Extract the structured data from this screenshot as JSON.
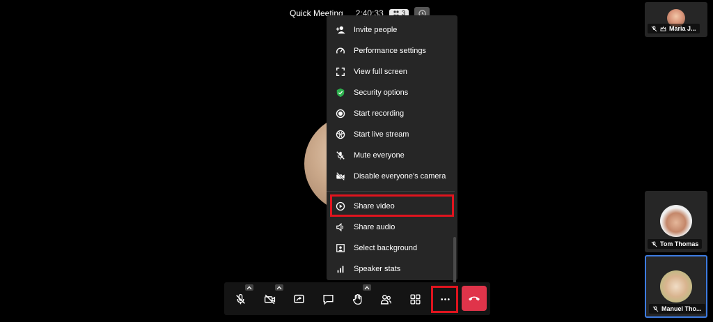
{
  "meeting": {
    "title": "Quick Meeting",
    "timer": "2:40:33",
    "participant_count": "3"
  },
  "menu": {
    "items": [
      {
        "label": "Invite people",
        "icon": "invite-people-icon"
      },
      {
        "label": "Performance settings",
        "icon": "performance-gauge-icon"
      },
      {
        "label": "View full screen",
        "icon": "fullscreen-icon"
      },
      {
        "label": "Security options",
        "icon": "security-shield-icon"
      },
      {
        "label": "Start recording",
        "icon": "record-icon"
      },
      {
        "label": "Start live stream",
        "icon": "live-stream-icon"
      },
      {
        "label": "Mute everyone",
        "icon": "mute-everyone-icon"
      },
      {
        "label": "Disable everyone's camera",
        "icon": "disable-camera-icon"
      },
      {
        "label": "Share video",
        "icon": "play-circle-icon"
      },
      {
        "label": "Share audio",
        "icon": "speaker-icon"
      },
      {
        "label": "Select background",
        "icon": "background-image-icon"
      },
      {
        "label": "Speaker stats",
        "icon": "stats-bars-icon"
      }
    ],
    "highlighted": "Share video"
  },
  "participants": [
    {
      "name": "Maria J...",
      "muted": true,
      "moderator": true
    },
    {
      "name": "Tom Thomas",
      "muted": true
    },
    {
      "name": "Manuel Tho...",
      "muted": true,
      "active_speaker": true
    }
  ],
  "colors": {
    "highlight": "#e0141e",
    "hangup": "#e0344a",
    "active_border": "#3d7be0",
    "security_shield": "#2cae4c"
  }
}
